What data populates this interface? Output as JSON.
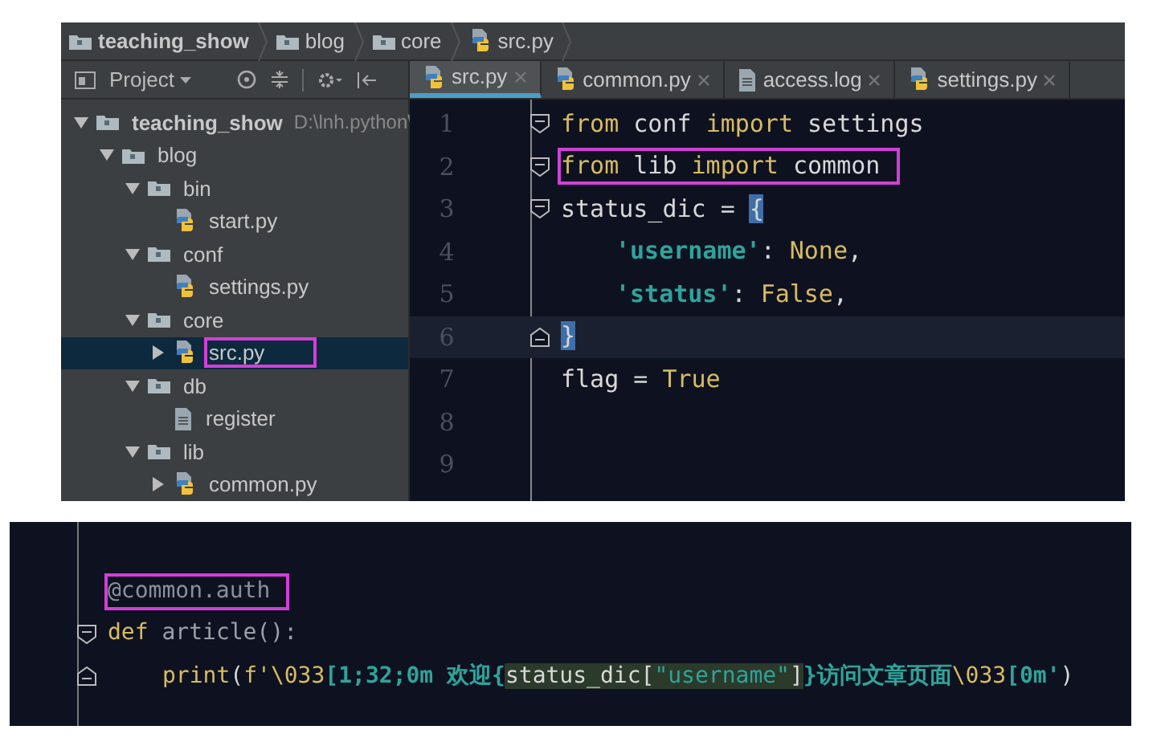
{
  "ide_window": {
    "breadcrumbs": [
      {
        "label": "teaching_show",
        "kind": "folder",
        "bold": true
      },
      {
        "label": "blog",
        "kind": "folder",
        "bold": false
      },
      {
        "label": "core",
        "kind": "folder",
        "bold": false
      },
      {
        "label": "src.py",
        "kind": "python",
        "bold": false
      }
    ],
    "project_toolbar": {
      "label": "Project"
    },
    "tree": [
      {
        "label": "teaching_show",
        "path": "D:\\lnh.python\\",
        "kind": "folder",
        "expanded": true,
        "selected": false,
        "highlighted": false,
        "children": [
          {
            "label": "blog",
            "kind": "folder",
            "expanded": true,
            "selected": false,
            "highlighted": false,
            "children": [
              {
                "label": "bin",
                "kind": "folder",
                "expanded": true,
                "selected": false,
                "highlighted": false,
                "children": [
                  {
                    "label": "start.py",
                    "kind": "python",
                    "selected": false,
                    "highlighted": false
                  }
                ]
              },
              {
                "label": "conf",
                "kind": "folder",
                "expanded": true,
                "selected": false,
                "highlighted": false,
                "children": [
                  {
                    "label": "settings.py",
                    "kind": "python",
                    "selected": false,
                    "highlighted": false
                  }
                ]
              },
              {
                "label": "core",
                "kind": "folder",
                "expanded": true,
                "selected": false,
                "highlighted": false,
                "children": [
                  {
                    "label": "src.py",
                    "kind": "python",
                    "expanded": false,
                    "selected": true,
                    "highlighted": true
                  }
                ]
              },
              {
                "label": "db",
                "kind": "folder",
                "expanded": true,
                "selected": false,
                "highlighted": false,
                "children": [
                  {
                    "label": "register",
                    "kind": "file",
                    "selected": false,
                    "highlighted": false
                  }
                ]
              },
              {
                "label": "lib",
                "kind": "folder",
                "expanded": true,
                "selected": false,
                "highlighted": false,
                "children": [
                  {
                    "label": "common.py",
                    "kind": "python",
                    "expanded": false,
                    "selected": false,
                    "highlighted": false
                  }
                ]
              }
            ]
          }
        ]
      }
    ],
    "tabs": [
      {
        "label": "src.py",
        "kind": "python",
        "selected": true
      },
      {
        "label": "common.py",
        "kind": "python",
        "selected": false
      },
      {
        "label": "access.log",
        "kind": "file",
        "selected": false
      },
      {
        "label": "settings.py",
        "kind": "python",
        "selected": false
      }
    ],
    "editor_lines": [
      {
        "number": "1",
        "fold_start": true,
        "current": false,
        "highlighted": false,
        "tokens": [
          {
            "text": "from",
            "kind": "keyword"
          },
          {
            "text": " conf ",
            "kind": "plain"
          },
          {
            "text": "import",
            "kind": "keyword"
          },
          {
            "text": " settings",
            "kind": "plain"
          }
        ]
      },
      {
        "number": "2",
        "fold_start": true,
        "current": false,
        "highlighted": true,
        "tokens": [
          {
            "text": "from",
            "kind": "keyword"
          },
          {
            "text": " lib ",
            "kind": "plain"
          },
          {
            "text": "import",
            "kind": "keyword"
          },
          {
            "text": " common",
            "kind": "plain"
          }
        ]
      },
      {
        "number": "3",
        "fold_start": true,
        "current": false,
        "highlighted": false,
        "tokens": [
          {
            "text": "status_dic = ",
            "kind": "plain"
          },
          {
            "text": "{",
            "kind": "brace_match"
          }
        ]
      },
      {
        "number": "4",
        "indented": true,
        "current": false,
        "highlighted": false,
        "tokens": [
          {
            "text": "'username'",
            "kind": "string"
          },
          {
            "text": ": ",
            "kind": "plain"
          },
          {
            "text": "None",
            "kind": "keyword"
          },
          {
            "text": ",",
            "kind": "plain"
          }
        ]
      },
      {
        "number": "5",
        "indented": true,
        "current": false,
        "highlighted": false,
        "tokens": [
          {
            "text": "'status'",
            "kind": "string"
          },
          {
            "text": ": ",
            "kind": "plain"
          },
          {
            "text": "False",
            "kind": "keyword"
          },
          {
            "text": ",",
            "kind": "plain"
          }
        ]
      },
      {
        "number": "6",
        "fold_end": true,
        "current": true,
        "highlighted": false,
        "tokens": [
          {
            "text": "}",
            "kind": "brace_match"
          }
        ]
      },
      {
        "number": "7",
        "current": false,
        "highlighted": false,
        "tokens": [
          {
            "text": "flag = ",
            "kind": "plain"
          },
          {
            "text": "True",
            "kind": "keyword"
          }
        ]
      },
      {
        "number": "8",
        "current": false
      },
      {
        "number": "9",
        "current": false
      }
    ]
  },
  "code_snippet": {
    "lines": [
      {
        "highlighted": true,
        "tokens": [
          {
            "text": "@common.auth",
            "kind": "decorator"
          }
        ]
      },
      {
        "fold_start": true,
        "highlighted": false,
        "tokens": [
          {
            "text": "def",
            "kind": "keyword"
          },
          {
            "text": " article():",
            "kind": "dim"
          }
        ]
      },
      {
        "fold_end": true,
        "indented": true,
        "highlighted": false,
        "tokens": [
          {
            "text": "print",
            "kind": "keyword"
          },
          {
            "text": "(",
            "kind": "plain"
          },
          {
            "text": "f'\\033",
            "kind": "keyword"
          },
          {
            "text": "[1;32;0m 欢迎{",
            "kind": "string"
          },
          {
            "text": "status_dic[",
            "kind": "plain_marked"
          },
          {
            "text": "\"username\"",
            "kind": "string_marked"
          },
          {
            "text": "]",
            "kind": "plain_marked"
          },
          {
            "text": "}访问文章页面",
            "kind": "string"
          },
          {
            "text": "\\033",
            "kind": "keyword"
          },
          {
            "text": "[0m'",
            "kind": "string"
          },
          {
            "text": ")",
            "kind": "plain"
          }
        ]
      }
    ]
  }
}
